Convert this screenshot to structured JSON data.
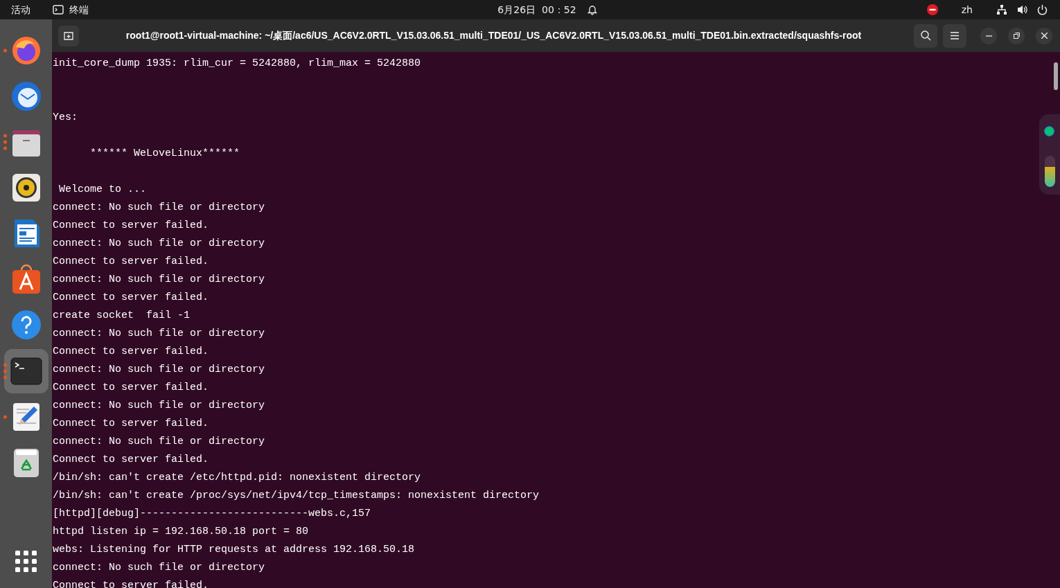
{
  "top_bar": {
    "activities": "活动",
    "app_name": "终端",
    "clock": "6月26日  00：52",
    "input_method": "zh"
  },
  "dock": {
    "items": [
      {
        "kind": "firefox",
        "running": true,
        "multiple_windows": false,
        "selected": false
      },
      {
        "kind": "mail",
        "running": false,
        "selected": false
      },
      {
        "kind": "files",
        "running": true,
        "multiple_windows": true,
        "selected": false
      },
      {
        "kind": "music",
        "running": false,
        "selected": false
      },
      {
        "kind": "writer",
        "running": false,
        "selected": false
      },
      {
        "kind": "store",
        "running": false,
        "selected": false
      },
      {
        "kind": "help",
        "running": false,
        "selected": false
      },
      {
        "kind": "terminal",
        "running": true,
        "multiple_windows": true,
        "selected": true
      },
      {
        "kind": "editor",
        "running": true,
        "multiple_windows": false,
        "selected": false
      },
      {
        "kind": "trash",
        "running": false,
        "selected": false
      }
    ]
  },
  "window": {
    "title": "root1@root1-virtual-machine: ~/桌面/ac6/US_AC6V2.0RTL_V15.03.06.51_multi_TDE01/_US_AC6V2.0RTL_V15.03.06.51_multi_TDE01.bin.extracted/squashfs-root",
    "terminal_lines": [
      {
        "kind": "text",
        "text": "init_core_dump 1935: rlim_cur = 5242880, rlim_max = 5242880"
      },
      {
        "kind": "blank"
      },
      {
        "kind": "blank"
      },
      {
        "kind": "text",
        "text": "Yes:"
      },
      {
        "kind": "blank"
      },
      {
        "kind": "text",
        "text": "      ****** WeLoveLinux******"
      },
      {
        "kind": "blank"
      },
      {
        "kind": "text",
        "text": " Welcome to ..."
      },
      {
        "kind": "text",
        "text": "connect: No such file or directory"
      },
      {
        "kind": "text",
        "text": "Connect to server failed."
      },
      {
        "kind": "text",
        "text": "connect: No such file or directory"
      },
      {
        "kind": "text",
        "text": "Connect to server failed."
      },
      {
        "kind": "text",
        "text": "connect: No such file or directory"
      },
      {
        "kind": "text",
        "text": "Connect to server failed."
      },
      {
        "kind": "text",
        "text": "create socket  fail -1"
      },
      {
        "kind": "text",
        "text": "connect: No such file or directory"
      },
      {
        "kind": "text",
        "text": "Connect to server failed."
      },
      {
        "kind": "text",
        "text": "connect: No such file or directory"
      },
      {
        "kind": "text",
        "text": "Connect to server failed."
      },
      {
        "kind": "text",
        "text": "connect: No such file or directory"
      },
      {
        "kind": "text",
        "text": "Connect to server failed."
      },
      {
        "kind": "text",
        "text": "connect: No such file or directory"
      },
      {
        "kind": "text",
        "text": "Connect to server failed."
      },
      {
        "kind": "text",
        "text": "/bin/sh: can't create /etc/httpd.pid: nonexistent directory"
      },
      {
        "kind": "text",
        "text": "/bin/sh: can't create /proc/sys/net/ipv4/tcp_timestamps: nonexistent directory"
      },
      {
        "kind": "text",
        "text": "[httpd][debug]---------------------------webs.c,157"
      },
      {
        "kind": "text",
        "text": "httpd listen ip = 192.168.50.18 port = 80"
      },
      {
        "kind": "text",
        "text": "webs: Listening for HTTP requests at address 192.168.50.18"
      },
      {
        "kind": "text",
        "text": "connect: No such file or directory"
      },
      {
        "kind": "text",
        "text": "Connect to server failed."
      }
    ]
  },
  "side_widget": {
    "status_dot": {
      "color": "#00c176"
    },
    "meter": {
      "level": 0.65
    }
  }
}
